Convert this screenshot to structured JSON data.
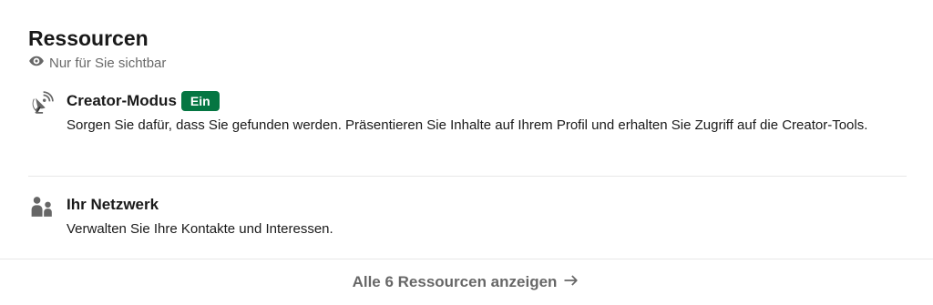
{
  "section": {
    "title": "Ressourcen",
    "visibility": "Nur für Sie sichtbar"
  },
  "items": [
    {
      "icon": "satellite-dish-icon",
      "title": "Creator-Modus",
      "badge": "Ein",
      "description": "Sorgen Sie dafür, dass Sie gefunden werden. Präsentieren Sie Inhalte auf Ihrem Profil und erhalten Sie Zugriff auf die Creator-Tools."
    },
    {
      "icon": "people-icon",
      "title": "Ihr Netzwerk",
      "description": "Verwalten Sie Ihre Kontakte und Interessen."
    }
  ],
  "footer": {
    "link_label": "Alle 6 Ressourcen anzeigen",
    "icon": "arrow-right-icon"
  },
  "colors": {
    "badge_bg": "#057642",
    "text_primary": "#1a1a1a",
    "text_secondary": "#666666"
  }
}
